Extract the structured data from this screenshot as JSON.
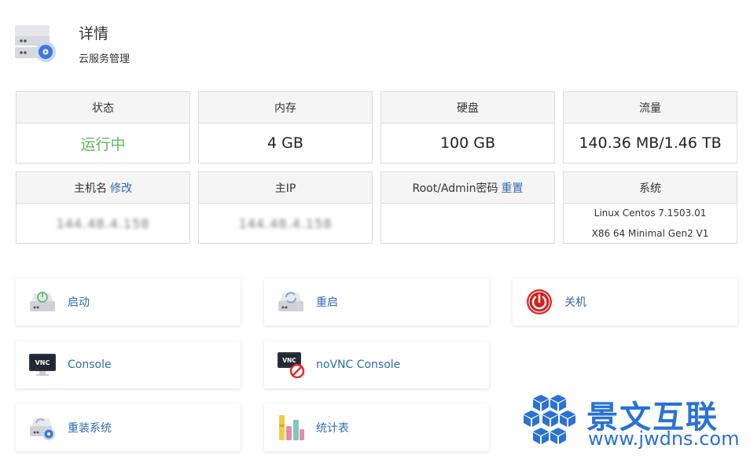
{
  "header": {
    "title": "详情",
    "subtitle": "云服务管理",
    "icon": "server-settings-icon"
  },
  "info": {
    "status": {
      "label": "状态",
      "value": "运行中",
      "color": "#5cb85c"
    },
    "memory": {
      "label": "内存",
      "value": "4 GB"
    },
    "disk": {
      "label": "硬盘",
      "value": "100 GB"
    },
    "traffic": {
      "label": "流量",
      "value": "140.36 MB/1.46 TB"
    },
    "hostname": {
      "label": "主机名",
      "link": "修改",
      "value": "144.48.4.158"
    },
    "main_ip": {
      "label": "主IP",
      "value": "144.48.4.158"
    },
    "root_password": {
      "label": "Root/Admin密码",
      "link": "重置",
      "value": ""
    },
    "system": {
      "label": "系统",
      "line1": "Linux Centos 7.1503.01",
      "line2": "X86 64 Minimal Gen2 V1"
    }
  },
  "actions": {
    "start": {
      "label": "启动",
      "icon": "power-on-disk-icon"
    },
    "reboot": {
      "label": "重启",
      "icon": "reboot-disk-icon"
    },
    "shutdown": {
      "label": "关机",
      "icon": "power-off-icon",
      "color": "#e02b2b"
    },
    "console": {
      "label": "Console",
      "icon": "vnc-monitor-icon"
    },
    "novnc": {
      "label": "noVNC Console",
      "icon": "vnc-blocked-icon"
    },
    "reinstall": {
      "label": "重装系统",
      "icon": "reinstall-disk-icon"
    },
    "stats": {
      "label": "统计表",
      "icon": "bar-stats-icon"
    }
  },
  "watermark": {
    "title": "景文互联",
    "url": "www.jwdns.com",
    "color": "#2a72d4"
  },
  "colors": {
    "link": "#2f6bb3",
    "accent_green": "#5cb85c"
  }
}
